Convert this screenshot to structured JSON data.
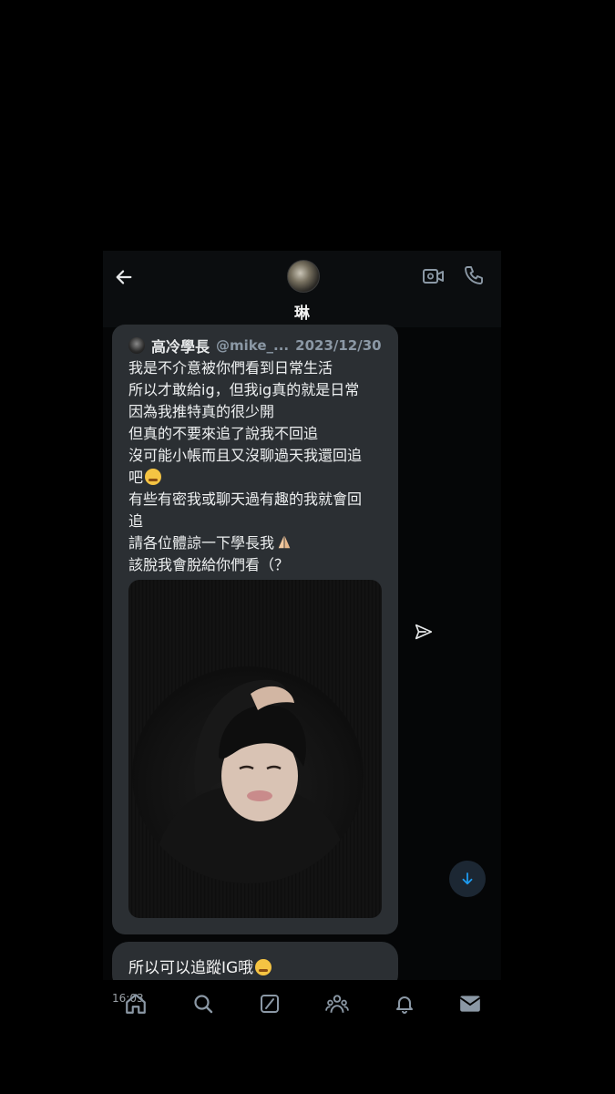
{
  "header": {
    "contact_name": "琳",
    "back_icon": "arrow-left-icon",
    "video_icon": "video-camera-icon",
    "call_icon": "phone-icon"
  },
  "tweet": {
    "author": "高冷學長",
    "handle": "@mike_...",
    "date": "2023/12/30",
    "lines": [
      "我是不介意被你們看到日常生活",
      "所以才敢給ig，但我ig真的就是日常",
      "因為我推特真的很少開",
      "但真的不要來追了說我不回追",
      "沒可能小帳而且又沒聊過天我還回追",
      "吧",
      "有些有密我或聊天過有趣的我就會回",
      "追",
      "請各位體諒一下學長我",
      "該脫我會脫給你們看（？"
    ]
  },
  "message": {
    "text": "所以可以追蹤IG哦"
  },
  "status": {
    "time": "16:03"
  },
  "nav": {
    "items": [
      "home-icon",
      "search-icon",
      "grok-icon",
      "communities-icon",
      "notifications-icon",
      "messages-icon"
    ]
  },
  "colors": {
    "accent": "#1d9bf0",
    "bubble": "#2b2f33",
    "background": "#000000"
  }
}
